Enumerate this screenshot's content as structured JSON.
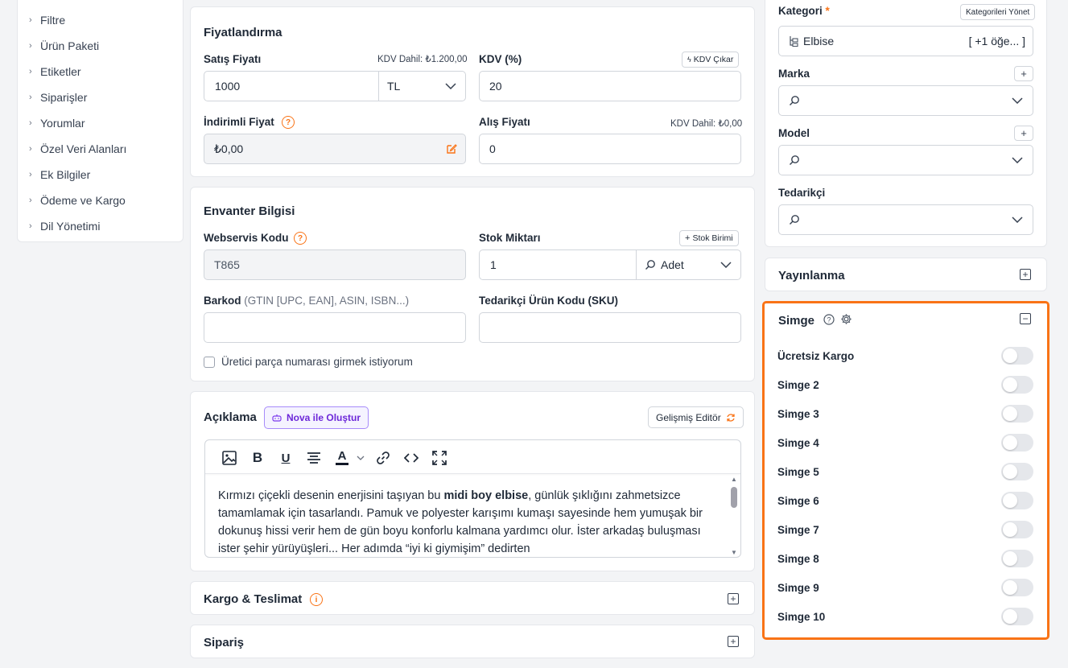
{
  "sidebar": {
    "items": [
      {
        "label": "Filtre"
      },
      {
        "label": "Ürün Paketi"
      },
      {
        "label": "Etiketler"
      },
      {
        "label": "Siparişler"
      },
      {
        "label": "Yorumlar"
      },
      {
        "label": "Özel Veri Alanları"
      },
      {
        "label": "Ek Bilgiler"
      },
      {
        "label": "Ödeme ve Kargo"
      },
      {
        "label": "Dil Yönetimi"
      }
    ]
  },
  "pricing": {
    "title": "Fiyatlandırma",
    "sale_price_label": "Satış Fiyatı",
    "sale_price_hint": "KDV Dahil: ₺1.200,00",
    "sale_price_value": "1000",
    "currency_value": "TL",
    "vat_label": "KDV (%)",
    "vat_button": "KDV Çıkar",
    "vat_value": "20",
    "discount_label": "İndirimli Fiyat",
    "discount_value": "₺0,00",
    "purchase_label": "Alış Fiyatı",
    "purchase_hint": "KDV Dahil: ₺0,00",
    "purchase_value": "0"
  },
  "inventory": {
    "title": "Envanter Bilgisi",
    "webservice_label": "Webservis Kodu",
    "webservice_value": "T865",
    "stock_label": "Stok Miktarı",
    "stock_unit_button": "Stok Birimi",
    "stock_value": "1",
    "stock_unit_value": "Adet",
    "barcode_label": "Barkod",
    "barcode_hint": "(GTIN [UPC, EAN], ASIN, ISBN...)",
    "supplier_code_label": "Tedarikçi Ürün Kodu (SKU)",
    "mpn_checkbox_label": "Üretici parça numarası girmek istiyorum"
  },
  "description": {
    "title": "Açıklama",
    "nova_button": "Nova ile Oluştur",
    "advanced_editor_button": "Gelişmiş Editör",
    "text_before_bold": "Kırmızı çiçekli desenin enerjisini taşıyan bu ",
    "text_bold": "midi boy elbise",
    "text_after_bold": ", günlük şıklığını zahmetsizce tamamlamak için tasarlandı. Pamuk ve polyester karışımı kumaşı sayesinde hem yumuşak bir dokunuş hissi verir hem de gün boyu konforlu kalmana yardımcı olur. İster arkadaş buluşması ister şehir yürüyüşleri... Her adımda “iyi ki giymişim” dedirten"
  },
  "shipping": {
    "title": "Kargo & Teslimat"
  },
  "order": {
    "title": "Sipariş"
  },
  "category_panel": {
    "category_label": "Kategori",
    "required_mark": "*",
    "manage_button": "Kategorileri Yönet",
    "category_value": "Elbise",
    "category_more": "[ +1 öğe... ]",
    "brand_label": "Marka",
    "model_label": "Model",
    "supplier_label": "Tedarikçi"
  },
  "publish": {
    "title": "Yayınlanma"
  },
  "simge": {
    "title": "Simge",
    "items": [
      {
        "label": "Ücretsiz Kargo",
        "on": false
      },
      {
        "label": "Simge 2",
        "on": false
      },
      {
        "label": "Simge 3",
        "on": false
      },
      {
        "label": "Simge 4",
        "on": false
      },
      {
        "label": "Simge 5",
        "on": false
      },
      {
        "label": "Simge 6",
        "on": false
      },
      {
        "label": "Simge 7",
        "on": false
      },
      {
        "label": "Simge 8",
        "on": false
      },
      {
        "label": "Simge 9",
        "on": false
      },
      {
        "label": "Simge 10",
        "on": false
      }
    ]
  },
  "colors": {
    "accent": "#f97316",
    "nova": "#7c3aed"
  }
}
